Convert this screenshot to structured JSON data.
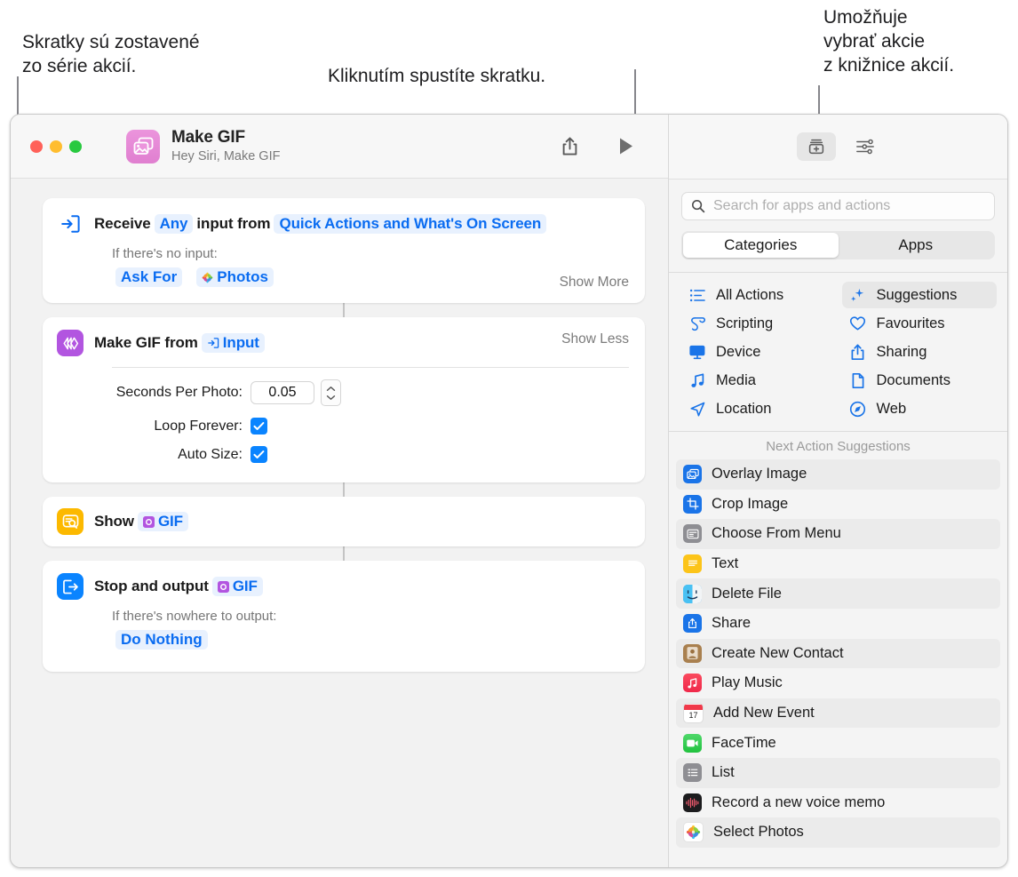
{
  "callouts": [
    {
      "id": "actions-series",
      "text": "Skratky sú zostavené\nzo série akcií."
    },
    {
      "id": "run-shortcut",
      "text": "Kliknutím spustíte skratku."
    },
    {
      "id": "action-library",
      "text": "Umožňuje\nvybrať akcie\nz knižnice akcií."
    }
  ],
  "window": {
    "titlebar": {
      "app_icon": "photos-stack-icon",
      "title": "Make GIF",
      "subtitle": "Hey Siri, Make GIF",
      "share_button": "share-icon",
      "run_button": "play-icon"
    },
    "right_titlebar": {
      "library_button": "action-library-icon",
      "details_button": "sliders-icon"
    },
    "flow": {
      "actions": [
        {
          "icon": "receive-input-icon",
          "icon_color": "#0a6cf1",
          "title": "Receive",
          "token1": "Any",
          "mid_text": "input from",
          "token2": "Quick Actions and What's On Screen",
          "sub_label": "If there's no input:",
          "tokens": [
            "Ask For",
            "Photos"
          ],
          "toggle": "Show More"
        },
        {
          "icon": "make-gif-icon",
          "icon_color": "#b255e0",
          "title": "Make GIF from",
          "token": "Input",
          "toggle": "Show Less",
          "params": [
            {
              "label": "Seconds Per Photo:",
              "type": "number",
              "value": "0.05"
            },
            {
              "label": "Loop Forever:",
              "type": "checkbox",
              "checked": true
            },
            {
              "label": "Auto Size:",
              "type": "checkbox",
              "checked": true
            }
          ]
        },
        {
          "icon": "quick-look-icon",
          "icon_color": "#fcb900",
          "title": "Show",
          "token": "GIF"
        },
        {
          "icon": "stop-output-icon",
          "icon_color": "#0a84ff",
          "title": "Stop and output",
          "token": "GIF",
          "sub_label": "If there's nowhere to output:",
          "tokens": [
            "Do Nothing"
          ]
        }
      ]
    },
    "sidebar": {
      "search": {
        "icon": "search-icon",
        "placeholder": "Search for apps and actions",
        "value": ""
      },
      "segments": [
        {
          "label": "Categories",
          "selected": true
        },
        {
          "label": "Apps",
          "selected": false
        }
      ],
      "categories": [
        {
          "label": "All Actions",
          "icon": "list-bullet-icon",
          "selected": false
        },
        {
          "label": "Suggestions",
          "icon": "sparkles-icon",
          "selected": true
        },
        {
          "label": "Scripting",
          "icon": "scroll-icon",
          "selected": false
        },
        {
          "label": "Favourites",
          "icon": "heart-icon",
          "selected": false
        },
        {
          "label": "Device",
          "icon": "display-icon",
          "selected": false
        },
        {
          "label": "Sharing",
          "icon": "share-icon",
          "selected": false
        },
        {
          "label": "Media",
          "icon": "music-note-icon",
          "selected": false
        },
        {
          "label": "Documents",
          "icon": "document-icon",
          "selected": false
        },
        {
          "label": "Location",
          "icon": "location-arrow-icon",
          "selected": false
        },
        {
          "label": "Web",
          "icon": "safari-compass-icon",
          "selected": false
        }
      ],
      "suggestions_title": "Next Action Suggestions",
      "suggestions": [
        {
          "label": "Overlay Image",
          "icon": "overlay-image-icon",
          "color": "#1a74e8"
        },
        {
          "label": "Crop Image",
          "icon": "crop-image-icon",
          "color": "#1a74e8"
        },
        {
          "label": "Choose From Menu",
          "icon": "choose-from-menu-icon",
          "color": "#8e8e93"
        },
        {
          "label": "Text",
          "icon": "text-icon",
          "color": "#fcc419"
        },
        {
          "label": "Delete File",
          "icon": "finder-icon",
          "color": "#4fb3f0"
        },
        {
          "label": "Share",
          "icon": "share-action-icon",
          "color": "#1a74e8"
        },
        {
          "label": "Create New Contact",
          "icon": "contacts-icon",
          "color": "#a9804f"
        },
        {
          "label": "Play Music",
          "icon": "music-icon",
          "color": "#f63a51"
        },
        {
          "label": "Add New Event",
          "icon": "calendar-icon",
          "color": "#ffffff"
        },
        {
          "label": "FaceTime",
          "icon": "facetime-icon",
          "color": "#31cd52"
        },
        {
          "label": "List",
          "icon": "list-icon",
          "color": "#8e8e93"
        },
        {
          "label": "Record a new voice memo",
          "icon": "voice-memos-icon",
          "color": "#1c1c1e"
        },
        {
          "label": "Select Photos",
          "icon": "photos-icon",
          "color": "#ffffff"
        }
      ]
    }
  }
}
